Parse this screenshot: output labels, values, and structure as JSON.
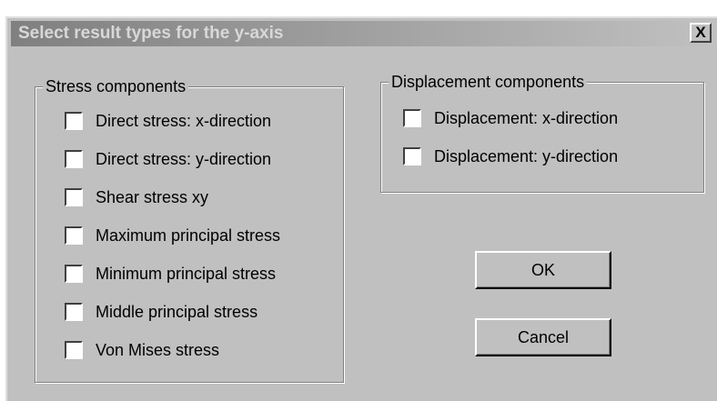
{
  "window": {
    "title": "Select result types for the y-axis",
    "close_label": "X"
  },
  "stress_group": {
    "legend": "Stress components",
    "items": [
      {
        "label": "Direct stress: x-direction",
        "checked": false
      },
      {
        "label": "Direct stress: y-direction",
        "checked": false
      },
      {
        "label": "Shear stress xy",
        "checked": false
      },
      {
        "label": "Maximum principal stress",
        "checked": false
      },
      {
        "label": "Minimum principal stress",
        "checked": false
      },
      {
        "label": "Middle principal stress",
        "checked": false
      },
      {
        "label": "Von Mises stress",
        "checked": false
      }
    ]
  },
  "displacement_group": {
    "legend": "Displacement components",
    "items": [
      {
        "label": "Displacement: x-direction",
        "checked": false
      },
      {
        "label": "Displacement: y-direction",
        "checked": false
      }
    ]
  },
  "buttons": {
    "ok_label": "OK",
    "cancel_label": "Cancel"
  }
}
